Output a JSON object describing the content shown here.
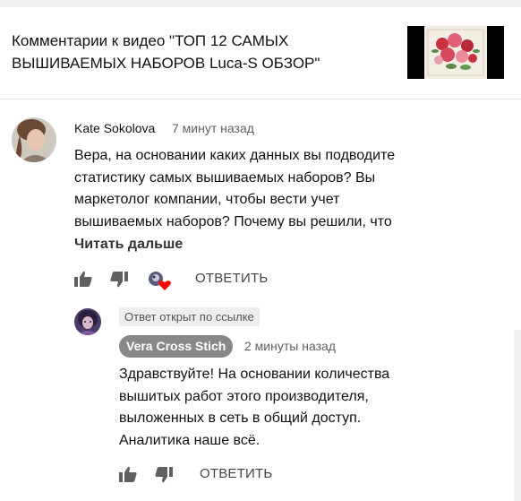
{
  "header": {
    "title_line1": "Комментарии к видео \"ТОП 12 САМЫХ",
    "title_line2": "ВЫШИВАЕМЫХ НАБОРОВ Luca-S ОБЗОР\""
  },
  "comment": {
    "author": "Kate Sokolova",
    "time": "7 минут назад",
    "lines": [
      "Вера, на основании каких данных вы подводите",
      "статистику самых вышиваемых наборов? Вы",
      "маркетолог компании, чтобы вести учет",
      "вышиваемых наборов? Почему вы решили, что"
    ],
    "read_more": "Читать дальше",
    "reply_label": "ОТВЕТИТЬ"
  },
  "reply": {
    "linked_badge": "Ответ открыт по ссылке",
    "author": "Vera Cross Stich",
    "time": "2 минуты назад",
    "lines": [
      "Здравствуйте! На основании количества",
      "вышитых работ этого производителя,",
      "выложенных в сеть в общий доступ.",
      "Аналитика наше всё."
    ],
    "reply_label": "ОТВЕТИТЬ"
  },
  "icons": {
    "like": "thumb-up-icon",
    "dislike": "thumb-down-icon",
    "creator_heart": "creator-heart-icon"
  },
  "colors": {
    "heart": "#ff0000",
    "owner_badge_bg": "#888888",
    "icon_gray": "#606060"
  }
}
